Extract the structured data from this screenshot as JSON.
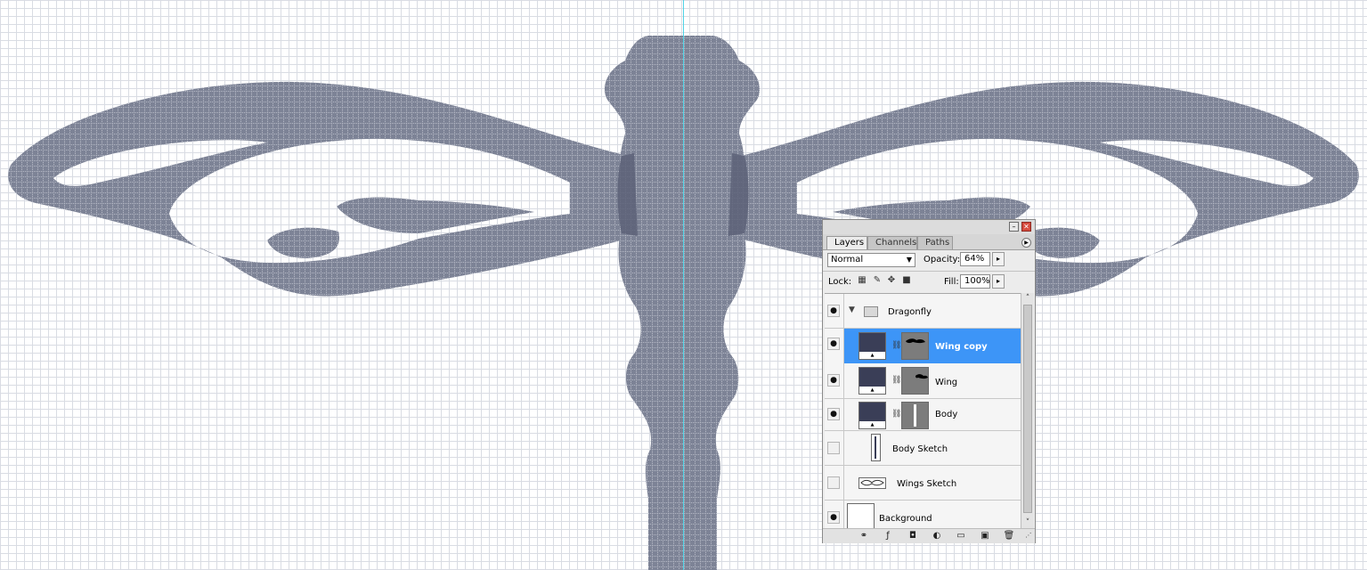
{
  "canvas": {
    "colors": {
      "grid": "#d9dce3",
      "shape_fill": "#7d8396",
      "shadow": "#5c6178",
      "guide": "#4fd3e6"
    }
  },
  "layers_panel": {
    "tabs": [
      {
        "label": "Layers",
        "active": true
      },
      {
        "label": "Channels",
        "active": false
      },
      {
        "label": "Paths",
        "active": false
      }
    ],
    "blend_mode": "Normal",
    "opacity_label": "Opacity:",
    "opacity_value": "64%",
    "lock_label": "Lock:",
    "fill_label": "Fill:",
    "fill_value": "100%",
    "layers": [
      {
        "name": "Dragonfly",
        "type": "group",
        "visible": true,
        "expanded": true,
        "selected": false
      },
      {
        "name": "Wing copy",
        "type": "fill-with-mask",
        "visible": true,
        "selected": true
      },
      {
        "name": "Wing",
        "type": "fill-with-mask",
        "visible": true,
        "selected": false
      },
      {
        "name": "Body",
        "type": "fill-with-mask",
        "visible": true,
        "selected": false
      },
      {
        "name": "Body Sketch",
        "type": "sketch",
        "visible": false,
        "selected": false
      },
      {
        "name": "Wings Sketch",
        "type": "sketch",
        "visible": false,
        "selected": false
      },
      {
        "name": "Background",
        "type": "background",
        "visible": true,
        "selected": false
      }
    ],
    "footer_icons": [
      "link-layers-icon",
      "layer-style-icon",
      "add-mask-icon",
      "adjustment-layer-icon",
      "new-group-icon",
      "new-layer-icon",
      "trash-icon"
    ],
    "colors": {
      "selected_row": "#3d95f7",
      "panel_bg": "#ececec",
      "fill_thumb": "#3a3e57"
    }
  }
}
